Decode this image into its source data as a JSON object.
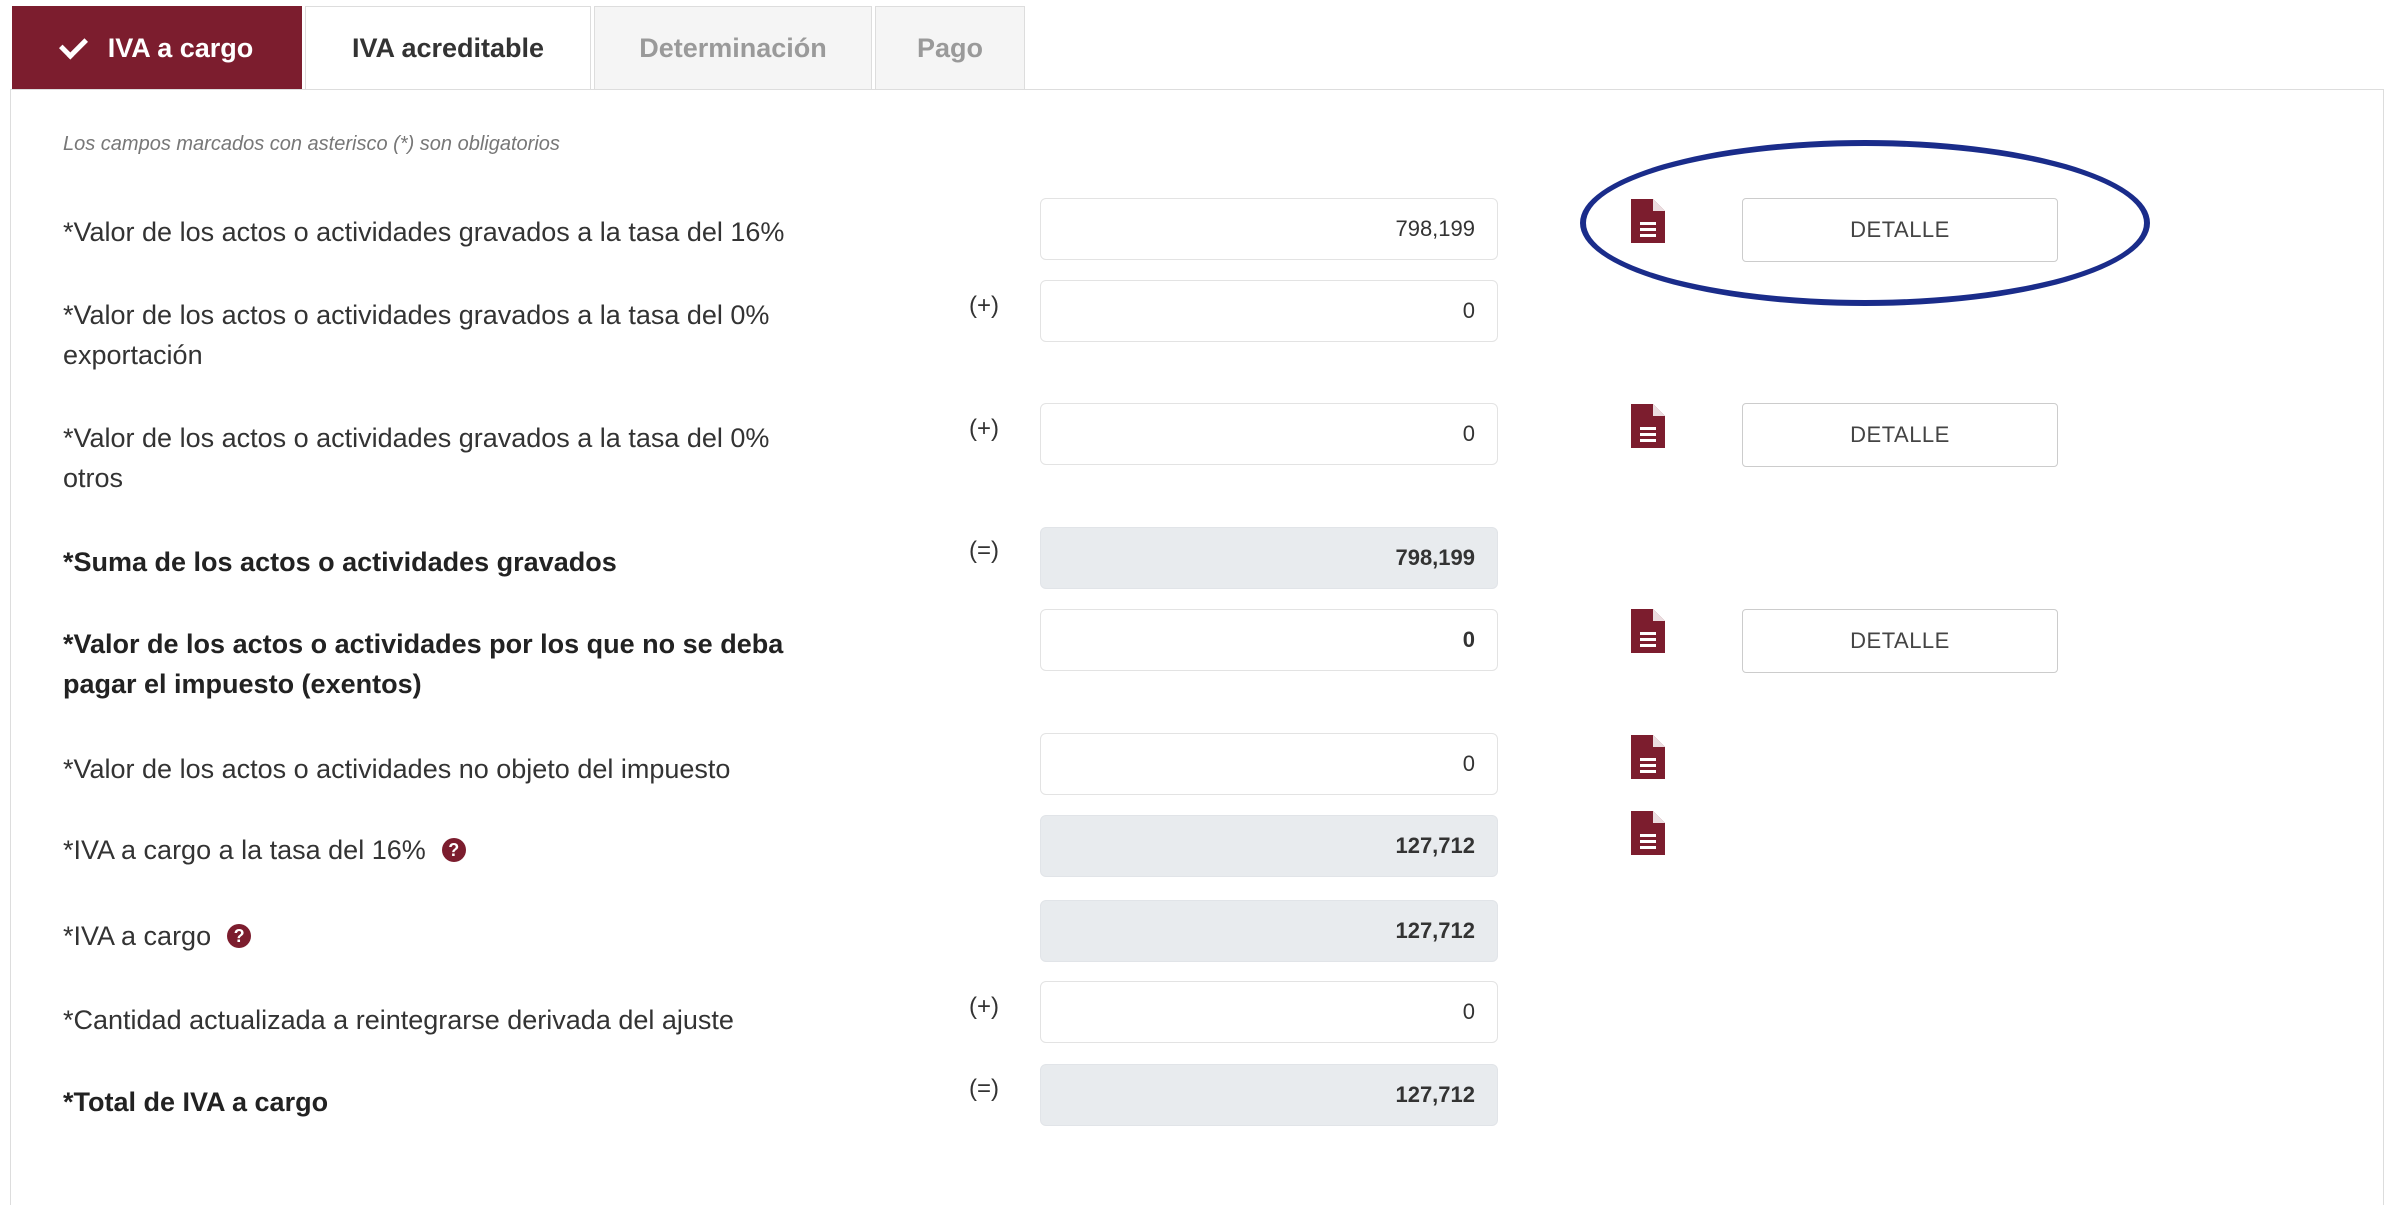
{
  "tabs": [
    {
      "label": "IVA a cargo",
      "state": "active"
    },
    {
      "label": "IVA acreditable",
      "state": "normal"
    },
    {
      "label": "Determinación",
      "state": "disabled"
    },
    {
      "label": "Pago",
      "state": "disabled"
    }
  ],
  "form": {
    "required_note": "Los campos marcados con asterisco (*) son obligatorios",
    "detail_label": "DETALLE",
    "rows": [
      {
        "label_line1": "*Valor de los actos o actividades gravados a la tasa del 16%",
        "label_line2": "",
        "operator": "",
        "value": "798,199",
        "readonly": false,
        "has_doc_icon": true,
        "has_detail": true
      },
      {
        "label_line1": "*Valor de los actos o actividades gravados a la tasa del 0%",
        "label_line2": "exportación",
        "operator": "(+)",
        "value": "0",
        "readonly": false,
        "has_doc_icon": false,
        "has_detail": false
      },
      {
        "label_line1": "*Valor de los actos o actividades gravados a la tasa del 0%",
        "label_line2": "otros",
        "operator": "(+)",
        "value": "0",
        "readonly": false,
        "has_doc_icon": true,
        "has_detail": true
      },
      {
        "label_line1": "*Suma de los actos o actividades gravados",
        "label_line2": "",
        "operator": "(=)",
        "value": "798,199",
        "readonly": true,
        "has_doc_icon": false,
        "has_detail": false
      },
      {
        "label_line1": "*Valor de los actos o actividades por los que no se deba",
        "label_line2": "pagar el impuesto (exentos)",
        "operator": "",
        "value": "0",
        "readonly": false,
        "has_doc_icon": true,
        "has_detail": true
      },
      {
        "label_line1": "*Valor de los actos o actividades no objeto del impuesto",
        "label_line2": "",
        "operator": "",
        "value": "0",
        "readonly": false,
        "has_doc_icon": true,
        "has_detail": false
      },
      {
        "label_line1": "*IVA a cargo a la tasa del 16%",
        "label_line2": "",
        "operator": "",
        "value": "127,712",
        "readonly": true,
        "has_doc_icon": true,
        "has_detail": false,
        "help": true
      },
      {
        "label_line1": "*IVA a cargo",
        "label_line2": "",
        "operator": "",
        "value": "127,712",
        "readonly": true,
        "has_doc_icon": false,
        "has_detail": false,
        "help": true
      },
      {
        "label_line1": "*Cantidad actualizada a reintegrarse derivada del ajuste",
        "label_line2": "",
        "operator": "(+)",
        "value": "0",
        "readonly": false,
        "has_doc_icon": false,
        "has_detail": false
      },
      {
        "label_line1": "*Total de IVA a cargo",
        "label_line2": "",
        "operator": "(=)",
        "value": "127,712",
        "readonly": true,
        "has_doc_icon": false,
        "has_detail": false
      }
    ]
  },
  "colors": {
    "brand": "#7c1d2e",
    "annotation": "#1a2c8a",
    "readonly_field": "#e8ebee"
  },
  "icons": {
    "document": "document-icon",
    "help": "help-circle-icon",
    "check": "check-icon"
  }
}
